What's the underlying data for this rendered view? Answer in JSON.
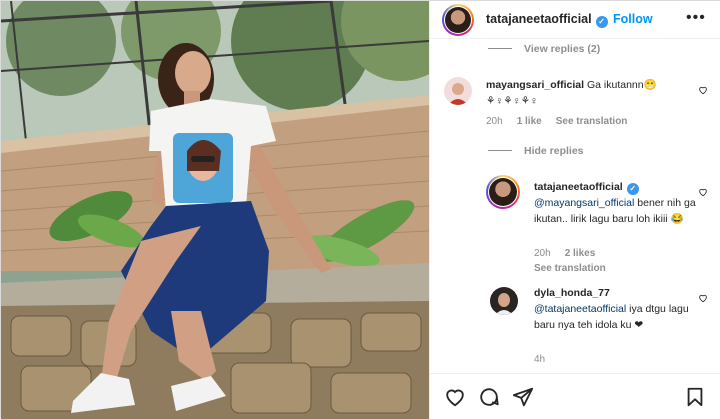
{
  "post": {
    "username": "tatajaneetaofficial",
    "follow_label": "Follow",
    "dot": "•",
    "more_label": "•••"
  },
  "comments": {
    "view_replies": "View replies (2)",
    "hide_replies": "Hide replies",
    "items": [
      {
        "username": "mayangsari_official",
        "text": "Ga ikutannn😁",
        "text_line2": "⚘♀⚘♀⚘♀",
        "time": "20h",
        "likes": "1 like",
        "see_translation": "See translation"
      },
      {
        "username": "tatajaneetaofficial",
        "mention": "@mayangsari_official",
        "text": " bener nih ga ikutan.. lirik lagu baru loh ikiii 😂",
        "time": "20h",
        "likes": "2 likes",
        "see_translation": "See translation"
      },
      {
        "username": "dyla_honda_77",
        "mention": "@tatajaneetaofficial",
        "text": " iya dtgu lagu baru nya teh idola ku ❤",
        "time": "4h"
      }
    ]
  },
  "icons": {
    "like": "heart-icon",
    "comment": "comment-icon",
    "share": "send-icon",
    "save": "bookmark-icon",
    "verified": "verified-badge-icon"
  },
  "colors": {
    "link_blue": "#0095f6",
    "verified_blue": "#3897f0",
    "muted": "#8e8e8e",
    "mention": "#00376b"
  }
}
